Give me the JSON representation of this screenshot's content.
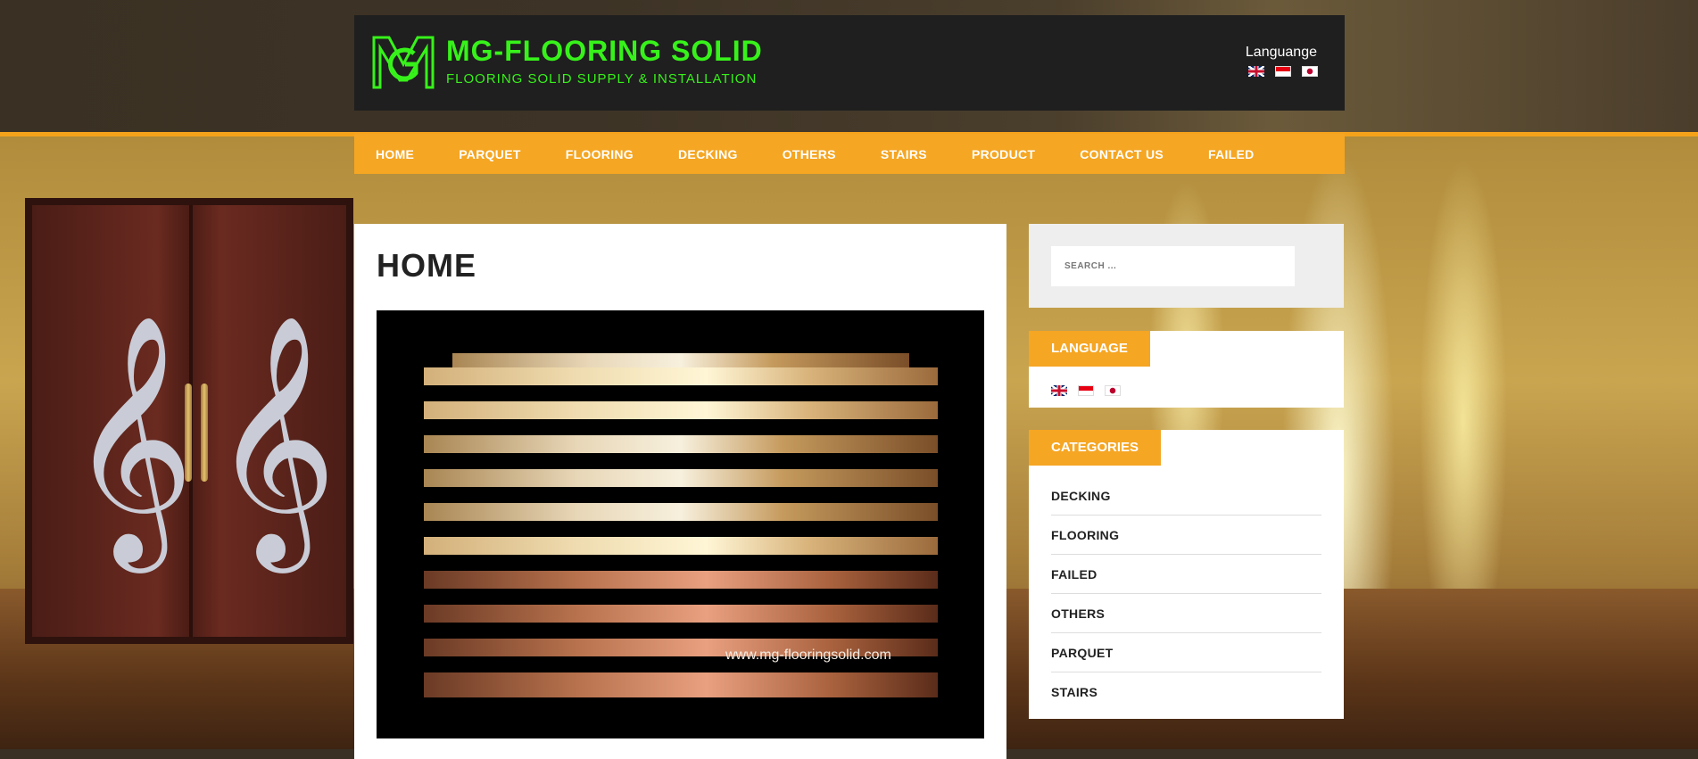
{
  "header": {
    "site_title": "MG-FLOORING SOLID",
    "tagline": "FLOORING SOLID SUPPLY & INSTALLATION",
    "language_label": "Languange",
    "logo_letters": "MG"
  },
  "languages": [
    {
      "code": "en",
      "icon": "uk-flag-icon"
    },
    {
      "code": "id",
      "icon": "indonesia-flag-icon"
    },
    {
      "code": "ja",
      "icon": "japan-flag-icon"
    }
  ],
  "nav": {
    "items": [
      {
        "label": "HOME"
      },
      {
        "label": "PARQUET"
      },
      {
        "label": "FLOORING"
      },
      {
        "label": "DECKING"
      },
      {
        "label": "OTHERS"
      },
      {
        "label": "STAIRS"
      },
      {
        "label": "PRODUCT"
      },
      {
        "label": "CONTACT US"
      },
      {
        "label": "FAILED"
      }
    ]
  },
  "main": {
    "title": "HOME",
    "image_watermark": "www.mg-flooringsolid.com"
  },
  "search": {
    "placeholder": "SEARCH ...",
    "value": ""
  },
  "sidebar": {
    "language_title": "LANGUAGE",
    "categories_title": "CATEGORIES",
    "categories": [
      "DECKING",
      "FLOORING",
      "FAILED",
      "OTHERS",
      "PARQUET",
      "STAIRS"
    ]
  },
  "colors": {
    "accent": "#f5a623",
    "logo_green": "#37f21a",
    "header_bg": "#1f1f1f"
  }
}
